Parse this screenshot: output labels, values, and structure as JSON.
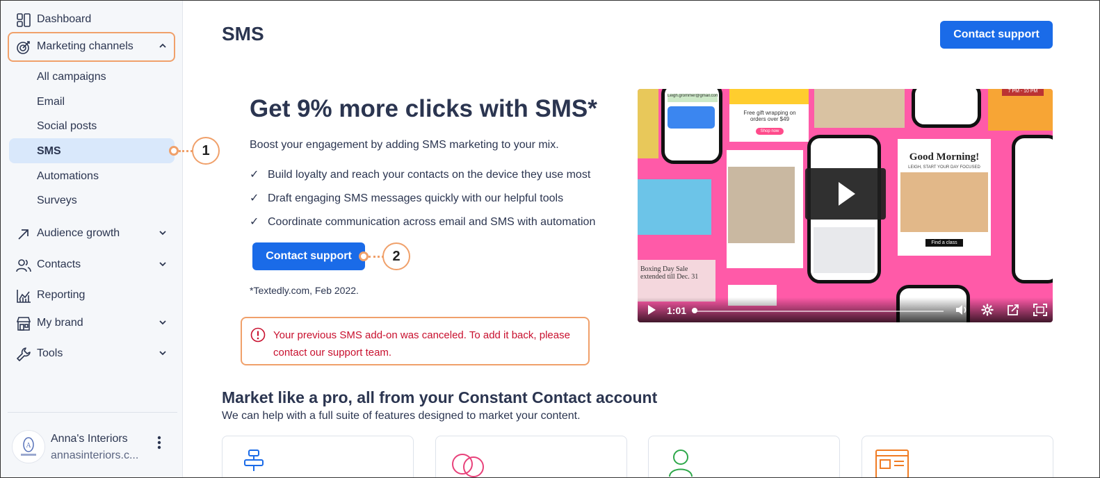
{
  "sidebar": {
    "dashboard": "Dashboard",
    "marketing_channels": "Marketing channels",
    "sub_items": [
      "All campaigns",
      "Email",
      "Social posts",
      "SMS",
      "Automations",
      "Surveys"
    ],
    "audience_growth": "Audience growth",
    "contacts": "Contacts",
    "reporting": "Reporting",
    "my_brand": "My brand",
    "tools": "Tools",
    "account": {
      "name": "Anna's Interiors",
      "sub": "annasinteriors.c..."
    }
  },
  "callouts": [
    "1",
    "2"
  ],
  "header": {
    "title": "SMS",
    "contact_button": "Contact support"
  },
  "hero": {
    "title": "Get 9% more clicks with SMS*",
    "subtitle": "Boost your engagement by adding SMS marketing to your mix.",
    "bullets": [
      "Build loyalty and reach your contacts on the device they use most",
      "Draft engaging SMS messages quickly with our helpful tools",
      "Coordinate communication across email and SMS with automation"
    ],
    "button": "Contact support",
    "footnote": "*Textedly.com, Feb 2022."
  },
  "alert": {
    "text": "Your previous SMS add-on was canceled. To add it back, please contact our support team."
  },
  "video": {
    "time": "1:01",
    "progress_fraction": 0.01,
    "thumb_texts": {
      "email": "Leigh.grommer@gmail.com",
      "gift": "Free gift wrapping on orders over $49",
      "shop": "Shop now",
      "good_morning": "Good Morning!",
      "leigh": "LEIGH, START YOUR DAY FOCUSED",
      "find_class": "Find a class",
      "boxing": "Boxing Day Sale extended till Dec. 31",
      "time_banner": "7 PM - 10 PM"
    }
  },
  "section": {
    "title": "Market like a pro, all from your Constant Contact account",
    "subtitle": "We can help with a full suite of features designed to market your content."
  },
  "colors": {
    "accent": "#1a6be8",
    "callout": "#f0a06a",
    "error": "#c8102e",
    "video_bg": "#ff5aa8"
  }
}
